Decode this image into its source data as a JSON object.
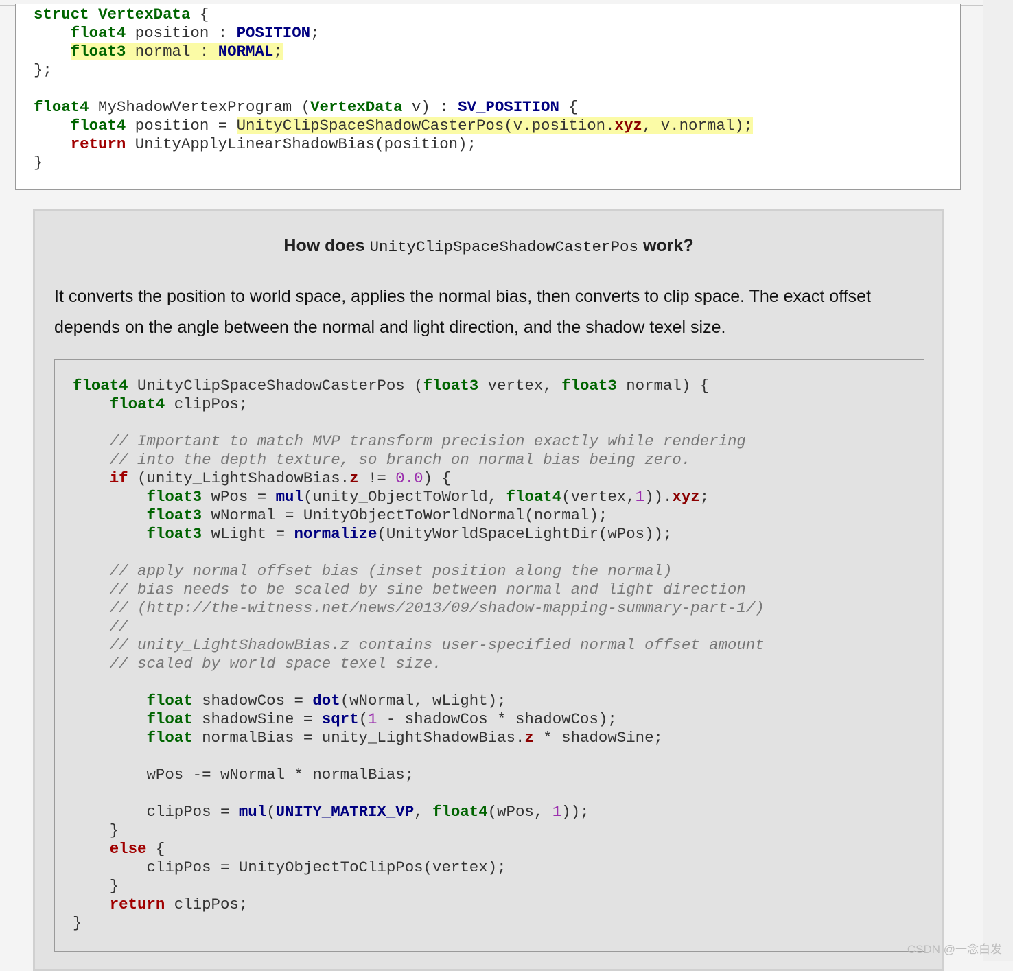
{
  "top_code": {
    "lines": [
      "struct VertexData {",
      "    float4 position : POSITION;",
      "    float3 normal : NORMAL;",
      "};",
      "",
      "float4 MyShadowVertexProgram (VertexData v) : SV_POSITION {",
      "    float4 position = UnityClipSpaceShadowCasterPos(v.position.xyz, v.normal);",
      "    return UnityApplyLinearShadowBias(position);",
      "}"
    ]
  },
  "note": {
    "title_before": "How does",
    "title_code": "UnityClipSpaceShadowCasterPos",
    "title_after": "work?",
    "paragraph": "It converts the position to world space, applies the normal bias, then converts to clip space. The exact offset depends on the angle between the normal and light direction, and the shadow texel size."
  },
  "note_code": {
    "lines": [
      "float4 UnityClipSpaceShadowCasterPos (float3 vertex, float3 normal) {",
      "    float4 clipPos;",
      "",
      "    // Important to match MVP transform precision exactly while rendering",
      "    // into the depth texture, so branch on normal bias being zero.",
      "    if (unity_LightShadowBias.z != 0.0) {",
      "        float3 wPos = mul(unity_ObjectToWorld, float4(vertex,1)).xyz;",
      "        float3 wNormal = UnityObjectToWorldNormal(normal);",
      "        float3 wLight = normalize(UnityWorldSpaceLightDir(wPos));",
      "",
      "    // apply normal offset bias (inset position along the normal)",
      "    // bias needs to be scaled by sine between normal and light direction",
      "    // (http://the-witness.net/news/2013/09/shadow-mapping-summary-part-1/)",
      "    //",
      "    // unity_LightShadowBias.z contains user-specified normal offset amount",
      "    // scaled by world space texel size.",
      "",
      "        float shadowCos = dot(wNormal, wLight);",
      "        float shadowSine = sqrt(1 - shadowCos * shadowCos);",
      "        float normalBias = unity_LightShadowBias.z * shadowSine;",
      "",
      "        wPos -= wNormal * normalBias;",
      "",
      "        clipPos = mul(UNITY_MATRIX_VP, float4(wPos, 1));",
      "    }",
      "    else {",
      "        clipPos = UnityObjectToClipPos(vertex);",
      "    }",
      "    return clipPos;",
      "}"
    ]
  },
  "watermark": "CSDN @一念白发"
}
